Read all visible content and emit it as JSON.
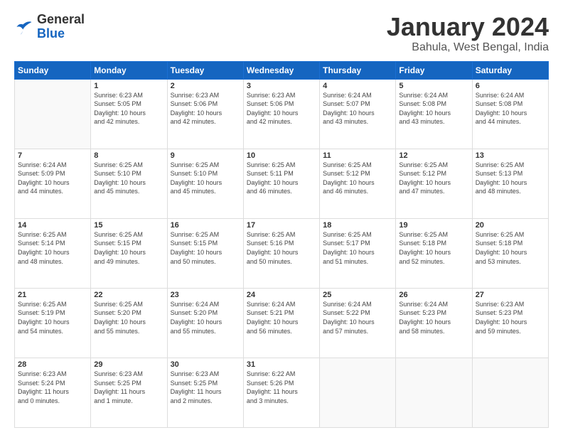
{
  "logo": {
    "general": "General",
    "blue": "Blue"
  },
  "title": "January 2024",
  "subtitle": "Bahula, West Bengal, India",
  "days_of_week": [
    "Sunday",
    "Monday",
    "Tuesday",
    "Wednesday",
    "Thursday",
    "Friday",
    "Saturday"
  ],
  "weeks": [
    [
      {
        "day": "",
        "info": ""
      },
      {
        "day": "1",
        "info": "Sunrise: 6:23 AM\nSunset: 5:05 PM\nDaylight: 10 hours\nand 42 minutes."
      },
      {
        "day": "2",
        "info": "Sunrise: 6:23 AM\nSunset: 5:06 PM\nDaylight: 10 hours\nand 42 minutes."
      },
      {
        "day": "3",
        "info": "Sunrise: 6:23 AM\nSunset: 5:06 PM\nDaylight: 10 hours\nand 42 minutes."
      },
      {
        "day": "4",
        "info": "Sunrise: 6:24 AM\nSunset: 5:07 PM\nDaylight: 10 hours\nand 43 minutes."
      },
      {
        "day": "5",
        "info": "Sunrise: 6:24 AM\nSunset: 5:08 PM\nDaylight: 10 hours\nand 43 minutes."
      },
      {
        "day": "6",
        "info": "Sunrise: 6:24 AM\nSunset: 5:08 PM\nDaylight: 10 hours\nand 44 minutes."
      }
    ],
    [
      {
        "day": "7",
        "info": "Sunrise: 6:24 AM\nSunset: 5:09 PM\nDaylight: 10 hours\nand 44 minutes."
      },
      {
        "day": "8",
        "info": "Sunrise: 6:25 AM\nSunset: 5:10 PM\nDaylight: 10 hours\nand 45 minutes."
      },
      {
        "day": "9",
        "info": "Sunrise: 6:25 AM\nSunset: 5:10 PM\nDaylight: 10 hours\nand 45 minutes."
      },
      {
        "day": "10",
        "info": "Sunrise: 6:25 AM\nSunset: 5:11 PM\nDaylight: 10 hours\nand 46 minutes."
      },
      {
        "day": "11",
        "info": "Sunrise: 6:25 AM\nSunset: 5:12 PM\nDaylight: 10 hours\nand 46 minutes."
      },
      {
        "day": "12",
        "info": "Sunrise: 6:25 AM\nSunset: 5:12 PM\nDaylight: 10 hours\nand 47 minutes."
      },
      {
        "day": "13",
        "info": "Sunrise: 6:25 AM\nSunset: 5:13 PM\nDaylight: 10 hours\nand 48 minutes."
      }
    ],
    [
      {
        "day": "14",
        "info": "Sunrise: 6:25 AM\nSunset: 5:14 PM\nDaylight: 10 hours\nand 48 minutes."
      },
      {
        "day": "15",
        "info": "Sunrise: 6:25 AM\nSunset: 5:15 PM\nDaylight: 10 hours\nand 49 minutes."
      },
      {
        "day": "16",
        "info": "Sunrise: 6:25 AM\nSunset: 5:15 PM\nDaylight: 10 hours\nand 50 minutes."
      },
      {
        "day": "17",
        "info": "Sunrise: 6:25 AM\nSunset: 5:16 PM\nDaylight: 10 hours\nand 50 minutes."
      },
      {
        "day": "18",
        "info": "Sunrise: 6:25 AM\nSunset: 5:17 PM\nDaylight: 10 hours\nand 51 minutes."
      },
      {
        "day": "19",
        "info": "Sunrise: 6:25 AM\nSunset: 5:18 PM\nDaylight: 10 hours\nand 52 minutes."
      },
      {
        "day": "20",
        "info": "Sunrise: 6:25 AM\nSunset: 5:18 PM\nDaylight: 10 hours\nand 53 minutes."
      }
    ],
    [
      {
        "day": "21",
        "info": "Sunrise: 6:25 AM\nSunset: 5:19 PM\nDaylight: 10 hours\nand 54 minutes."
      },
      {
        "day": "22",
        "info": "Sunrise: 6:25 AM\nSunset: 5:20 PM\nDaylight: 10 hours\nand 55 minutes."
      },
      {
        "day": "23",
        "info": "Sunrise: 6:24 AM\nSunset: 5:20 PM\nDaylight: 10 hours\nand 55 minutes."
      },
      {
        "day": "24",
        "info": "Sunrise: 6:24 AM\nSunset: 5:21 PM\nDaylight: 10 hours\nand 56 minutes."
      },
      {
        "day": "25",
        "info": "Sunrise: 6:24 AM\nSunset: 5:22 PM\nDaylight: 10 hours\nand 57 minutes."
      },
      {
        "day": "26",
        "info": "Sunrise: 6:24 AM\nSunset: 5:23 PM\nDaylight: 10 hours\nand 58 minutes."
      },
      {
        "day": "27",
        "info": "Sunrise: 6:23 AM\nSunset: 5:23 PM\nDaylight: 10 hours\nand 59 minutes."
      }
    ],
    [
      {
        "day": "28",
        "info": "Sunrise: 6:23 AM\nSunset: 5:24 PM\nDaylight: 11 hours\nand 0 minutes."
      },
      {
        "day": "29",
        "info": "Sunrise: 6:23 AM\nSunset: 5:25 PM\nDaylight: 11 hours\nand 1 minute."
      },
      {
        "day": "30",
        "info": "Sunrise: 6:23 AM\nSunset: 5:25 PM\nDaylight: 11 hours\nand 2 minutes."
      },
      {
        "day": "31",
        "info": "Sunrise: 6:22 AM\nSunset: 5:26 PM\nDaylight: 11 hours\nand 3 minutes."
      },
      {
        "day": "",
        "info": ""
      },
      {
        "day": "",
        "info": ""
      },
      {
        "day": "",
        "info": ""
      }
    ]
  ]
}
